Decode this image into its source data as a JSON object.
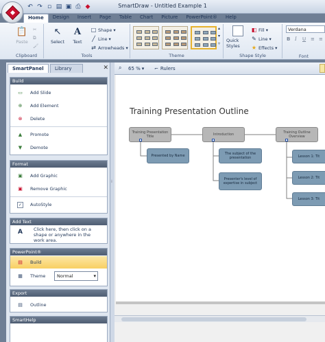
{
  "window": {
    "title": "SmartDraw - Untitled Example 1"
  },
  "ribbon_tabs": [
    "Home",
    "Design",
    "Insert",
    "Page",
    "Table",
    "Chart",
    "Picture",
    "PowerPoint®",
    "Help"
  ],
  "ribbon": {
    "clipboard": {
      "paste_label": "Paste",
      "group_label": "Clipboard"
    },
    "tools": {
      "select_label": "Select",
      "text_label": "Text",
      "shape_label": "Shape",
      "line_label": "Line",
      "arrowheads_label": "Arrowheads",
      "group_label": "Tools"
    },
    "theme": {
      "group_label": "Theme"
    },
    "shape_style": {
      "quick_styles_label": "Quick Styles",
      "fill_label": "Fill",
      "line_label": "Line",
      "effects_label": "Effects",
      "group_label": "Shape Style"
    },
    "font": {
      "font_name": "Verdana",
      "group_label": "Font"
    }
  },
  "panel": {
    "tabs": [
      "SmartPanel",
      "Library"
    ],
    "close_glyph": "✕",
    "build": {
      "title": "Build",
      "items": [
        "Add Slide",
        "Add Element",
        "Delete",
        "Promote",
        "Demote"
      ]
    },
    "format": {
      "title": "Format",
      "items": [
        "Add Graphic",
        "Remove Graphic",
        "AutoStyle"
      ]
    },
    "add_text": {
      "title": "Add Text",
      "text": "Click here, then click on a shape or anywhere in the work area."
    },
    "powerpoint": {
      "title": "PowerPoint®",
      "build_label": "Build",
      "theme_label": "Theme",
      "theme_value": "Normal"
    },
    "export": {
      "title": "Export",
      "outline_label": "Outline"
    },
    "smarthelp": {
      "title": "SmartHelp"
    }
  },
  "canvas_toolbar": {
    "zoom": "65 %",
    "rulers_label": "Rulers"
  },
  "canvas": {
    "title": "Training Presentation Outline",
    "nodes": {
      "title_node": "Training Presentation Title",
      "introduction": "Introduction",
      "overview": "Training Outline Overview",
      "presented_by": "Presented by Name",
      "subject": "The subject of the presentation",
      "presenter": "Presenter's level of expertise in subject",
      "lesson1": "Lesson 1: Tit",
      "lesson2": "Lesson 2: Tit",
      "lesson3": "Lesson 3: Tit"
    }
  },
  "colors": {
    "accent": "#f8cf63",
    "section_header": "#56657a",
    "node_blue": "#7d9bb3",
    "node_gray": "#b7b7b7"
  }
}
